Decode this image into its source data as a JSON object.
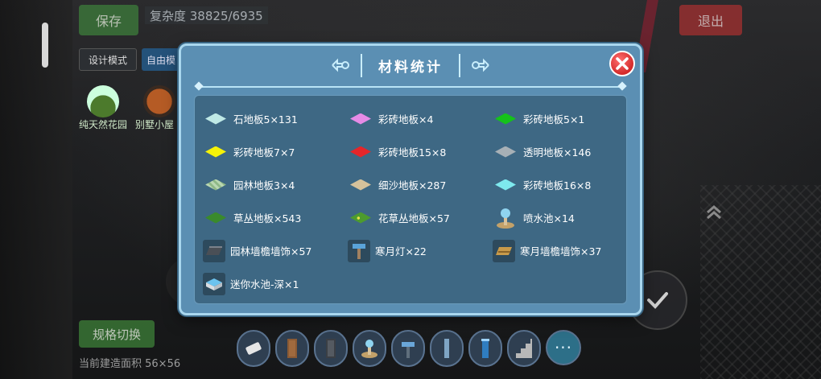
{
  "hud": {
    "save_label": "保存",
    "complexity_label": "复杂度 38825/6935",
    "design_mode_label": "设计模式",
    "free_mode_label": "自由模",
    "presets": [
      {
        "label": "纯天然花园"
      },
      {
        "label": "别墅小屋"
      }
    ],
    "exit_label": "退出",
    "switch_label": "规格切换",
    "area_text": "当前建造面积 56×56"
  },
  "dialog": {
    "title": "材料统计",
    "items": [
      {
        "label": "石地板5×131",
        "icon": "pale-cyan-floor-tile",
        "color": "#bfe9e6"
      },
      {
        "label": "彩砖地板×4",
        "icon": "pink-floor-tile",
        "color": "#e68be6"
      },
      {
        "label": "彩砖地板5×1",
        "icon": "green-floor-tile",
        "color": "#15c21a"
      },
      {
        "label": "彩砖地板7×7",
        "icon": "yellow-floor-tile",
        "color": "#f6f208"
      },
      {
        "label": "彩砖地板15×8",
        "icon": "red-floor-tile",
        "color": "#e5262a"
      },
      {
        "label": "透明地板×146",
        "icon": "gray-floor-tile",
        "color": "#a7b0b6"
      },
      {
        "label": "园林地板3×4",
        "icon": "garden-floor-tile",
        "color": "#b9d7b1"
      },
      {
        "label": "细沙地板×287",
        "icon": "sand-floor-tile",
        "color": "#d6c29b"
      },
      {
        "label": "彩砖地板16×8",
        "icon": "light-cyan-floor-tile",
        "color": "#7ee9ee"
      },
      {
        "label": "草丛地板×543",
        "icon": "grass-floor-tile",
        "color": "#3a8a2c"
      },
      {
        "label": "花草丛地板×57",
        "icon": "flower-grass-floor-tile",
        "color": "#4d9b2e"
      },
      {
        "label": "喷水池×14",
        "icon": "fountain-icon",
        "color": "#8fd4f0"
      },
      {
        "label": "园林墙檐墙饰×57",
        "icon": "garden-eave-icon",
        "color": "#4a4f56"
      },
      {
        "label": "寒月灯×22",
        "icon": "moon-lamp-icon",
        "color": "#5aa3d8"
      },
      {
        "label": "寒月墙檐墙饰×37",
        "icon": "moon-eave-icon",
        "color": "#c89a4a"
      },
      {
        "label": "迷你水池-深×1",
        "icon": "mini-pool-icon",
        "color": "#6cc3ef"
      }
    ]
  },
  "hotbar": {
    "slots": [
      {
        "icon": "eraser-icon"
      },
      {
        "icon": "wood-door-icon"
      },
      {
        "icon": "dark-door-icon"
      },
      {
        "icon": "fountain-icon"
      },
      {
        "icon": "lamp-icon"
      },
      {
        "icon": "column-icon"
      },
      {
        "icon": "blue-column-icon"
      },
      {
        "icon": "stairs-icon"
      }
    ],
    "more_label": "···"
  }
}
